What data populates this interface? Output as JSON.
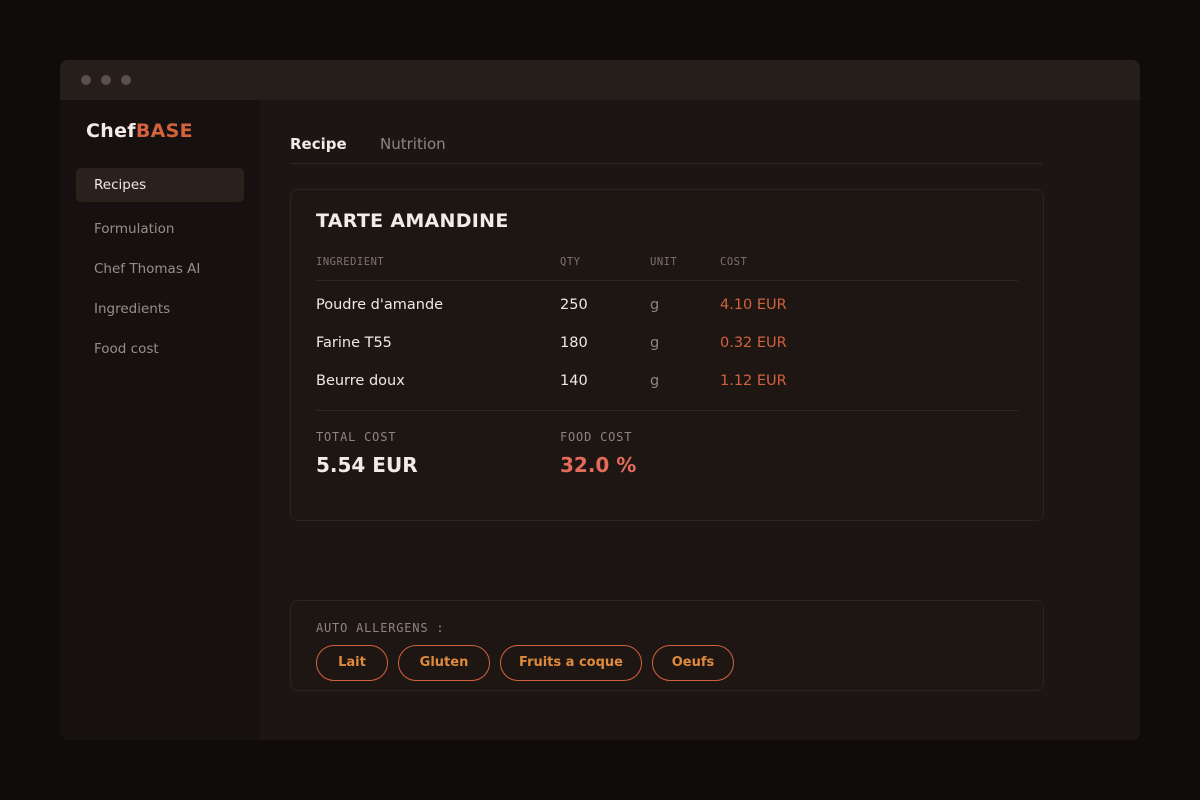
{
  "app": {
    "brand_part1": "Chef",
    "brand_part2": "BASE"
  },
  "sidebar": {
    "items": [
      {
        "label": "Recipes",
        "active": true
      },
      {
        "label": "Formulation"
      },
      {
        "label": "Chef Thomas AI"
      },
      {
        "label": "Ingredients"
      },
      {
        "label": "Food cost"
      }
    ]
  },
  "tabs": [
    {
      "label": "Recipe",
      "active": true
    },
    {
      "label": "Nutrition"
    }
  ],
  "recipe": {
    "title": "TARTE AMANDINE",
    "columns": [
      "INGREDIENT",
      "QTY",
      "UNIT",
      "COST"
    ],
    "rows": [
      {
        "ingredient": "Poudre d'amande",
        "qty": "250",
        "unit": "g",
        "cost": "4.10 EUR"
      },
      {
        "ingredient": "Farine T55",
        "qty": "180",
        "unit": "g",
        "cost": "0.32 EUR"
      },
      {
        "ingredient": "Beurre doux",
        "qty": "140",
        "unit": "g",
        "cost": "1.12 EUR"
      }
    ],
    "total_cost_label": "TOTAL COST",
    "total_cost_value": "5.54 EUR",
    "food_cost_label": "FOOD COST",
    "food_cost_value": "32.0 %"
  },
  "allergens": {
    "label": "AUTO ALLERGENS :",
    "tags": [
      "Lait",
      "Gluten",
      "Fruits a coque",
      "Oeufs"
    ]
  },
  "colors": {
    "background": "#100c0a",
    "window": "#1c1513",
    "accent": "#d3623f",
    "tag_text": "#e08a3c",
    "food_cost": "#e36b5b"
  }
}
